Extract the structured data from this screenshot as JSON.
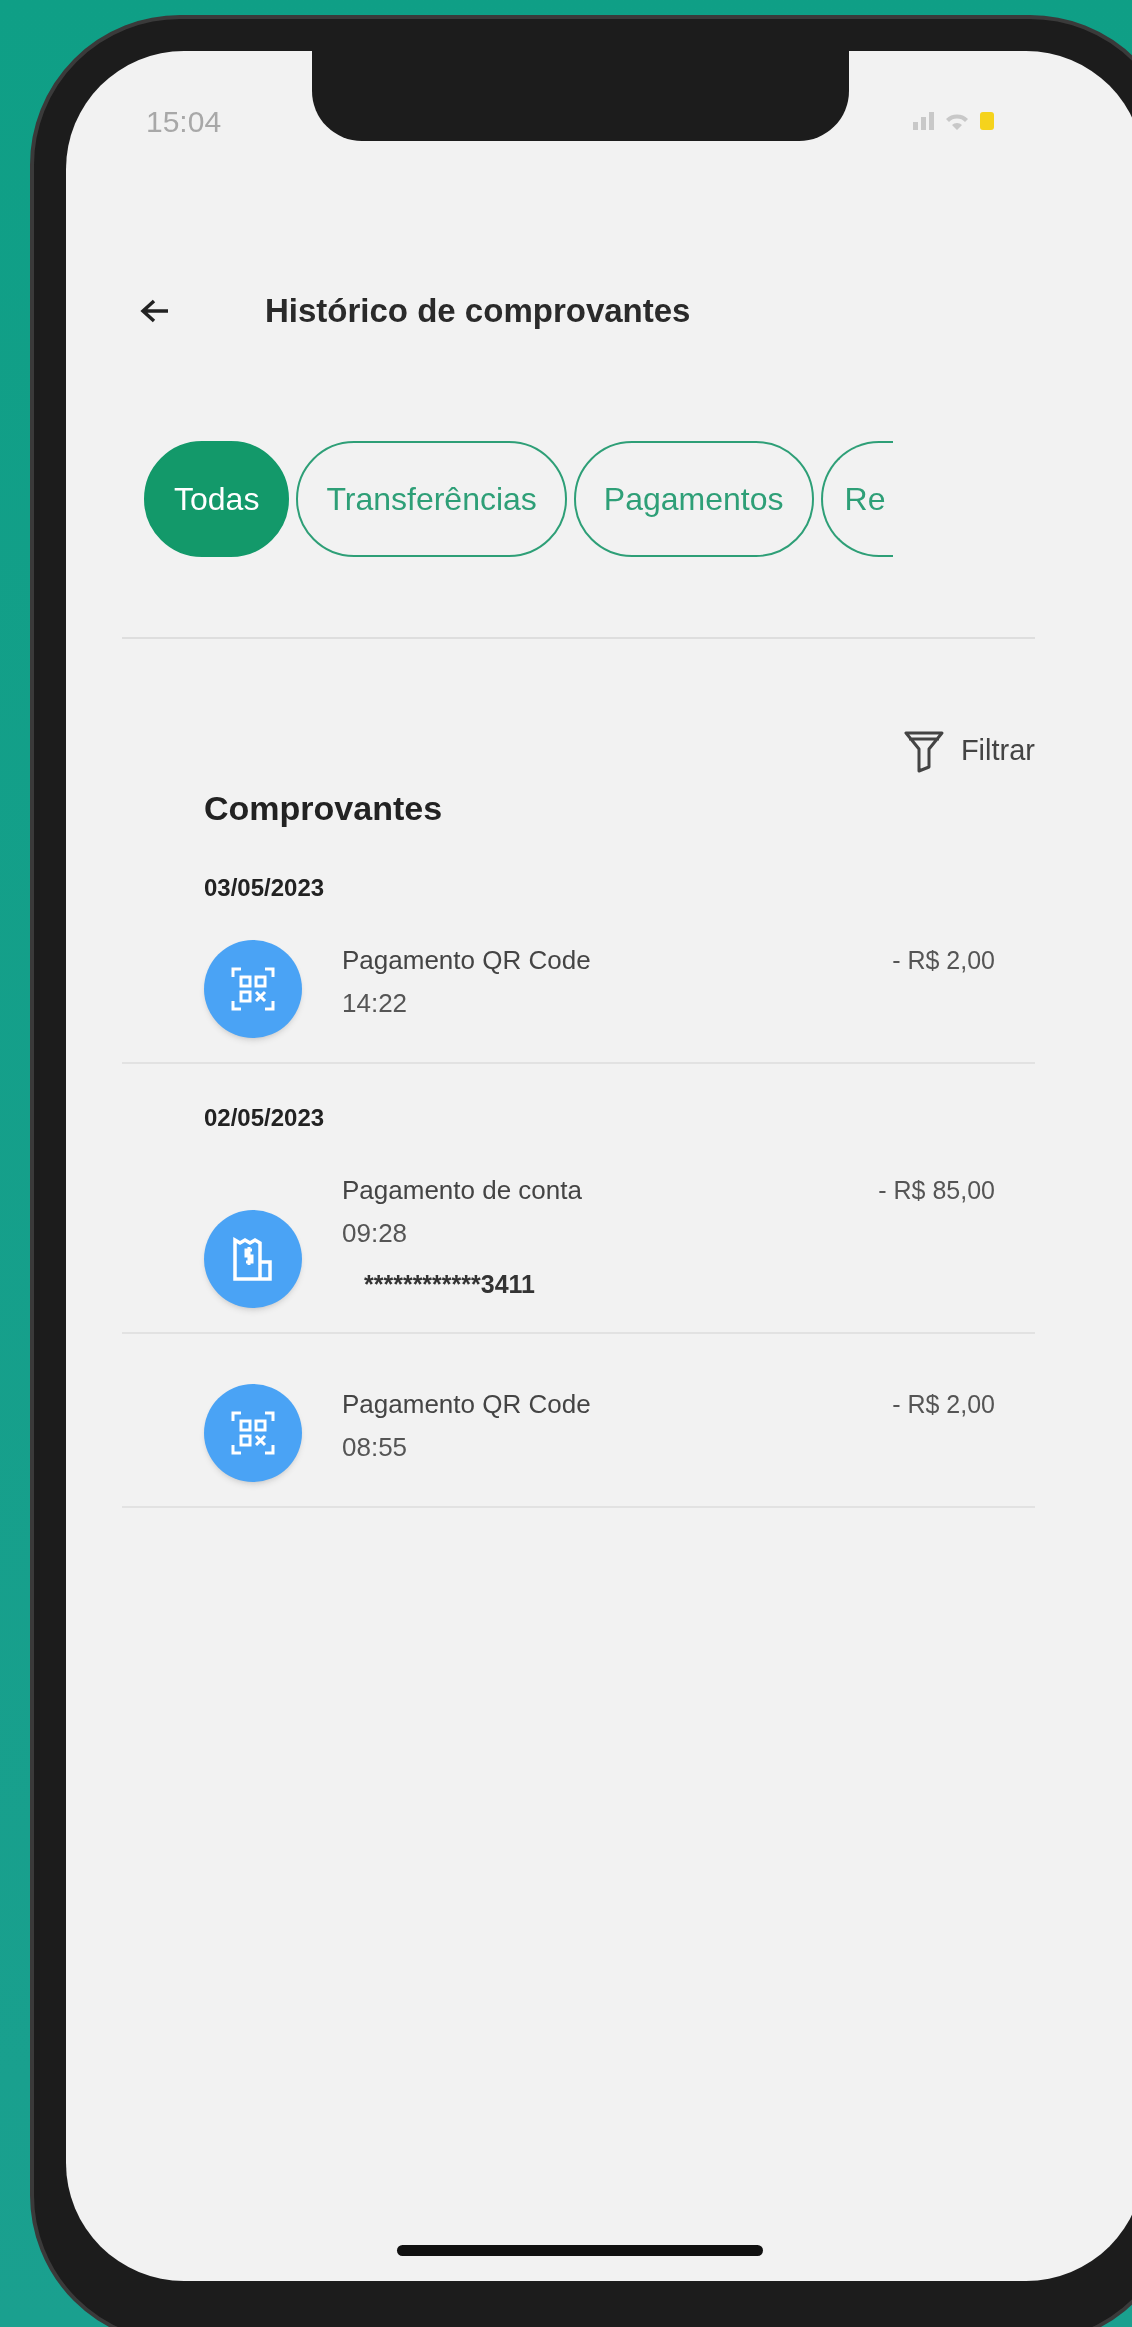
{
  "status_bar": {
    "time": "15:04"
  },
  "header": {
    "title": "Histórico de comprovantes"
  },
  "tabs": [
    {
      "label": "Todas",
      "selected": true
    },
    {
      "label": "Transferências",
      "selected": false
    },
    {
      "label": "Pagamentos",
      "selected": false
    },
    {
      "label": "Re",
      "selected": false
    }
  ],
  "filter": {
    "label": "Filtrar"
  },
  "section_title": "Comprovantes",
  "groups": [
    {
      "date": "03/05/2023",
      "items": [
        {
          "kind": "qr",
          "title": "Pagamento QR Code",
          "time": "14:22",
          "amount": "- R$ 2,00"
        }
      ]
    },
    {
      "date": "02/05/2023",
      "items": [
        {
          "kind": "bill",
          "title": "Pagamento de conta",
          "time": "09:28",
          "amount": "- R$ 85,00",
          "masked": "************3411"
        },
        {
          "kind": "qr",
          "title": "Pagamento QR Code",
          "time": "08:55",
          "amount": "- R$ 2,00"
        }
      ]
    }
  ]
}
